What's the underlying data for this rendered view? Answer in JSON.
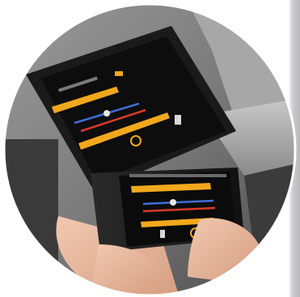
{
  "photo": {
    "subject": "hands-holding-smartphone-in-front-of-wall-mounted-control-panel",
    "colors": {
      "background_wall": "#7a7a7a",
      "panel_frame": "#141414",
      "panel_screen": "#0b0b0b",
      "accent_orange": "#f2a81d",
      "accent_blue": "#3f6fd8",
      "accent_red": "#d83a2a",
      "skin": "#e8b9a0",
      "right_strip": "#c9c9cc"
    }
  }
}
